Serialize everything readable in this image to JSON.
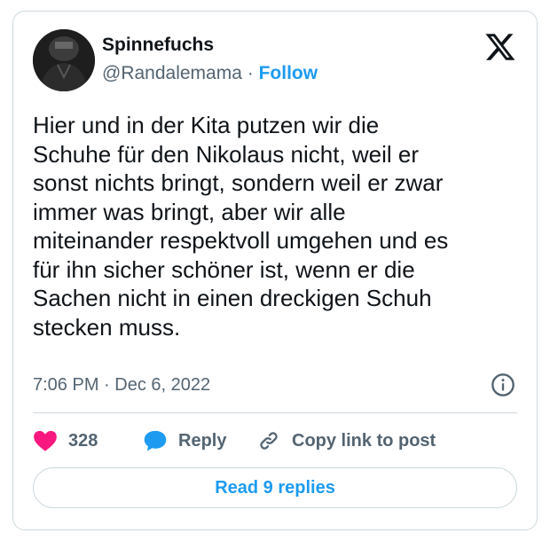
{
  "author": {
    "display_name": "Spinnefuchs",
    "handle": "@Randalemama",
    "separator": "·",
    "follow_label": "Follow"
  },
  "tweet": {
    "text": "Hier und in der Kita putzen wir die\nSchuhe für den Nikolaus nicht, weil er\nsonst nichts bringt, sondern weil er zwar\nimmer was bringt, aber wir alle\nmiteinander respektvoll umgehen und es\nfür ihn sicher schöner ist, wenn er die\nSachen nicht in einen dreckigen Schuh\nstecken muss.",
    "time": "7:06 PM",
    "separator": "·",
    "date": "Dec 6, 2022"
  },
  "actions": {
    "like_count": "328",
    "reply_label": "Reply",
    "copy_link_label": "Copy link to post"
  },
  "footer": {
    "read_replies_label": "Read 9 replies"
  },
  "colors": {
    "accent": "#1d9bf0",
    "like": "#f91880",
    "text": "#0f1419",
    "muted": "#536471",
    "border": "#cfd9de"
  },
  "icons": {
    "logo": "x-logo-icon",
    "info": "info-icon",
    "like": "heart-icon",
    "reply": "speech-bubble-icon",
    "copy": "link-icon"
  }
}
